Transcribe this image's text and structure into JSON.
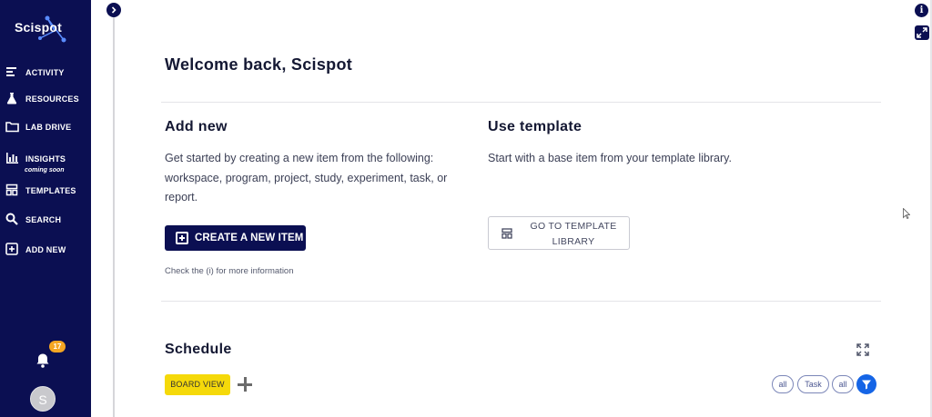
{
  "sidebar": {
    "logo_text": "Scispot",
    "items": [
      {
        "label": "ACTIVITY",
        "icon": "activity-icon"
      },
      {
        "label": "RESOURCES",
        "icon": "flask-icon"
      },
      {
        "label": "LAB DRIVE",
        "icon": "folder-icon"
      },
      {
        "label": "INSIGHTS",
        "icon": "chart-icon",
        "sub": "coming soon"
      },
      {
        "label": "TEMPLATES",
        "icon": "template-icon"
      },
      {
        "label": "SEARCH",
        "icon": "search-icon"
      },
      {
        "label": "ADD NEW",
        "icon": "plus-square-icon"
      }
    ],
    "notification_count": "17",
    "avatar_initial": "S"
  },
  "main": {
    "welcome": "Welcome back, Scispot",
    "add_new": {
      "title": "Add new",
      "description": "Get started by creating a new item from the following: workspace, program, project, study, experiment, task, or report.",
      "button_label": "CREATE A NEW ITEM",
      "hint": "Check the (i) for more information"
    },
    "use_template": {
      "title": "Use template",
      "description": "Start with a base item from your template library.",
      "button_label": "GO TO TEMPLATE LIBRARY"
    },
    "schedule": {
      "title": "Schedule",
      "view_label": "BOARD VIEW",
      "filters": [
        "all",
        "Task",
        "all"
      ]
    }
  },
  "controls": {
    "info_label": "i"
  },
  "colors": {
    "sidebar_bg": "#0b0f52",
    "badge": "#f5a623",
    "board_view": "#f5d90a",
    "filter": "#1565e6"
  }
}
